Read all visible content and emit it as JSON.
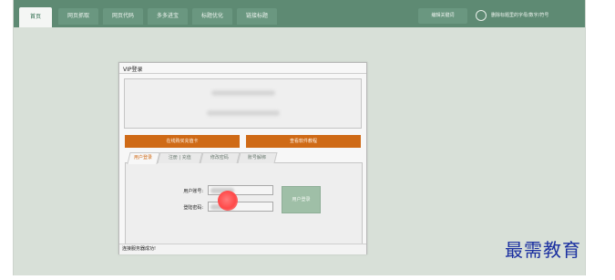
{
  "nav": {
    "tabs": [
      {
        "label": "首页",
        "active": true
      },
      {
        "label": "网页抓取"
      },
      {
        "label": "网页代码"
      },
      {
        "label": "多多进宝"
      },
      {
        "label": "标题优化"
      },
      {
        "label": "链接标题"
      }
    ],
    "tool_button": "编辑关键词",
    "hint": "删除标题里的字母/数字/符号"
  },
  "window": {
    "title": "VIP登录",
    "buttons": {
      "buy_card": "在线购买充值卡",
      "tutorial": "查看软件教程"
    },
    "tabs": [
      "用户登录",
      "注册 | 充值",
      "修改密码",
      "账号解绑"
    ],
    "form": {
      "account_label": "用户账号:",
      "password_label": "登陆密码:",
      "login_button": "用户登录"
    },
    "status": "连接服务器成功!"
  },
  "watermark": "最需教育",
  "colors": {
    "top_bar": "#5e8a73",
    "accent_orange": "#cf6a16",
    "login_button": "#9fbfa7",
    "cursor": "#ff4a4a",
    "watermark": "#1a2fa0"
  }
}
